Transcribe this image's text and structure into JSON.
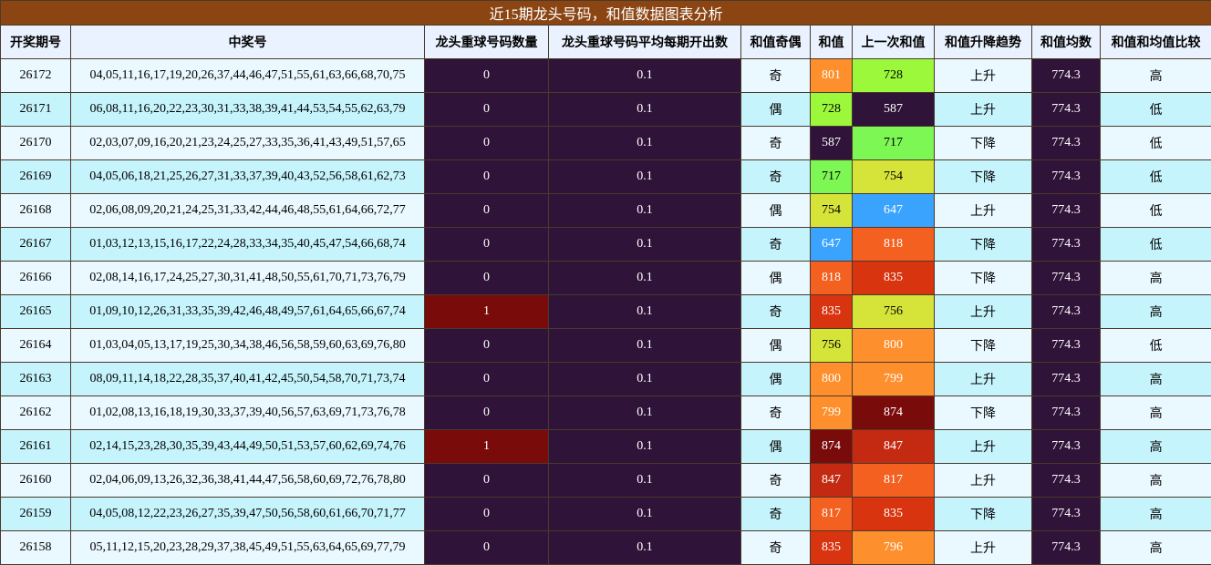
{
  "title": "近15期龙头号码，和值数据图表分析",
  "colors": {
    "title_bg": "#8b4513",
    "header_bg": "#eaf2ff",
    "row_light": "#eaf8ff",
    "row_cyan": "#c6f4fc",
    "count_zero": "#2f1338",
    "count_one": "#7a0b0b",
    "avg_bg": "#2f1338",
    "mean_bg": "#2f1338"
  },
  "headers": [
    "开奖期号",
    "中奖号",
    "龙头重球号码数量",
    "龙头重球号码平均每期开出数",
    "和值奇偶",
    "和值",
    "上一次和值",
    "和值升降趋势",
    "和值均数",
    "和值和均值比较"
  ],
  "rows": [
    {
      "issue": "26172",
      "numbers": "04,05,11,16,17,19,20,26,37,44,46,47,51,55,61,63,66,68,70,75",
      "repeat_count": "0",
      "repeat_avg": "0.1",
      "parity": "奇",
      "sum": "801",
      "sum_color": "#fe8f2d",
      "prev_sum": "728",
      "prev_color": "#9cf83a",
      "trend": "上升",
      "mean": "774.3",
      "compare": "高"
    },
    {
      "issue": "26171",
      "numbers": "06,08,11,16,20,22,23,30,31,33,38,39,41,44,53,54,55,62,63,79",
      "repeat_count": "0",
      "repeat_avg": "0.1",
      "parity": "偶",
      "sum": "728",
      "sum_color": "#9cf83a",
      "prev_sum": "587",
      "prev_color": "#2f1338",
      "trend": "上升",
      "mean": "774.3",
      "compare": "低"
    },
    {
      "issue": "26170",
      "numbers": "02,03,07,09,16,20,21,23,24,25,27,33,35,36,41,43,49,51,57,65",
      "repeat_count": "0",
      "repeat_avg": "0.1",
      "parity": "奇",
      "sum": "587",
      "sum_color": "#2f1338",
      "prev_sum": "717",
      "prev_color": "#7df754",
      "trend": "下降",
      "mean": "774.3",
      "compare": "低"
    },
    {
      "issue": "26169",
      "numbers": "04,05,06,18,21,25,26,27,31,33,37,39,40,43,52,56,58,61,62,73",
      "repeat_count": "0",
      "repeat_avg": "0.1",
      "parity": "奇",
      "sum": "717",
      "sum_color": "#7df754",
      "prev_sum": "754",
      "prev_color": "#d6e43a",
      "trend": "下降",
      "mean": "774.3",
      "compare": "低"
    },
    {
      "issue": "26168",
      "numbers": "02,06,08,09,20,21,24,25,31,33,42,44,46,48,55,61,64,66,72,77",
      "repeat_count": "0",
      "repeat_avg": "0.1",
      "parity": "偶",
      "sum": "754",
      "sum_color": "#d6e43a",
      "prev_sum": "647",
      "prev_color": "#3aa3fe",
      "trend": "上升",
      "mean": "774.3",
      "compare": "低"
    },
    {
      "issue": "26167",
      "numbers": "01,03,12,13,15,16,17,22,24,28,33,34,35,40,45,47,54,66,68,74",
      "repeat_count": "0",
      "repeat_avg": "0.1",
      "parity": "奇",
      "sum": "647",
      "sum_color": "#3aa3fe",
      "prev_sum": "818",
      "prev_color": "#f36020",
      "trend": "下降",
      "mean": "774.3",
      "compare": "低"
    },
    {
      "issue": "26166",
      "numbers": "02,08,14,16,17,24,25,27,30,31,41,48,50,55,61,70,71,73,76,79",
      "repeat_count": "0",
      "repeat_avg": "0.1",
      "parity": "偶",
      "sum": "818",
      "sum_color": "#f36020",
      "prev_sum": "835",
      "prev_color": "#d93410",
      "trend": "下降",
      "mean": "774.3",
      "compare": "高"
    },
    {
      "issue": "26165",
      "numbers": "01,09,10,12,26,31,33,35,39,42,46,48,49,57,61,64,65,66,67,74",
      "repeat_count": "1",
      "repeat_avg": "0.1",
      "parity": "奇",
      "sum": "835",
      "sum_color": "#d93410",
      "prev_sum": "756",
      "prev_color": "#d6e43a",
      "trend": "上升",
      "mean": "774.3",
      "compare": "高"
    },
    {
      "issue": "26164",
      "numbers": "01,03,04,05,13,17,19,25,30,34,38,46,56,58,59,60,63,69,76,80",
      "repeat_count": "0",
      "repeat_avg": "0.1",
      "parity": "偶",
      "sum": "756",
      "sum_color": "#d6e43a",
      "prev_sum": "800",
      "prev_color": "#fe8f2d",
      "trend": "下降",
      "mean": "774.3",
      "compare": "低"
    },
    {
      "issue": "26163",
      "numbers": "08,09,11,14,18,22,28,35,37,40,41,42,45,50,54,58,70,71,73,74",
      "repeat_count": "0",
      "repeat_avg": "0.1",
      "parity": "偶",
      "sum": "800",
      "sum_color": "#fe8f2d",
      "prev_sum": "799",
      "prev_color": "#fe8f2d",
      "trend": "上升",
      "mean": "774.3",
      "compare": "高"
    },
    {
      "issue": "26162",
      "numbers": "01,02,08,13,16,18,19,30,33,37,39,40,56,57,63,69,71,73,76,78",
      "repeat_count": "0",
      "repeat_avg": "0.1",
      "parity": "奇",
      "sum": "799",
      "sum_color": "#fe8f2d",
      "prev_sum": "874",
      "prev_color": "#7a0b0b",
      "trend": "下降",
      "mean": "774.3",
      "compare": "高"
    },
    {
      "issue": "26161",
      "numbers": "02,14,15,23,28,30,35,39,43,44,49,50,51,53,57,60,62,69,74,76",
      "repeat_count": "1",
      "repeat_avg": "0.1",
      "parity": "偶",
      "sum": "874",
      "sum_color": "#7a0b0b",
      "prev_sum": "847",
      "prev_color": "#c42a12",
      "trend": "上升",
      "mean": "774.3",
      "compare": "高"
    },
    {
      "issue": "26160",
      "numbers": "02,04,06,09,13,26,32,36,38,41,44,47,56,58,60,69,72,76,78,80",
      "repeat_count": "0",
      "repeat_avg": "0.1",
      "parity": "奇",
      "sum": "847",
      "sum_color": "#c42a12",
      "prev_sum": "817",
      "prev_color": "#f36020",
      "trend": "上升",
      "mean": "774.3",
      "compare": "高"
    },
    {
      "issue": "26159",
      "numbers": "04,05,08,12,22,23,26,27,35,39,47,50,56,58,60,61,66,70,71,77",
      "repeat_count": "0",
      "repeat_avg": "0.1",
      "parity": "奇",
      "sum": "817",
      "sum_color": "#f36020",
      "prev_sum": "835",
      "prev_color": "#d93410",
      "trend": "下降",
      "mean": "774.3",
      "compare": "高"
    },
    {
      "issue": "26158",
      "numbers": "05,11,12,15,20,23,28,29,37,38,45,49,51,55,63,64,65,69,77,79",
      "repeat_count": "0",
      "repeat_avg": "0.1",
      "parity": "奇",
      "sum": "835",
      "sum_color": "#d93410",
      "prev_sum": "796",
      "prev_color": "#fe8f2d",
      "trend": "上升",
      "mean": "774.3",
      "compare": "高"
    }
  ]
}
